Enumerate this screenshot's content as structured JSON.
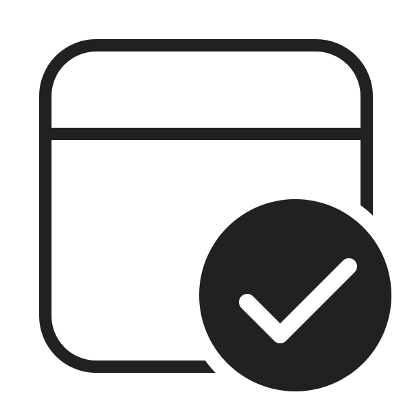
{
  "icon": {
    "name": "calendar-checkmark-icon",
    "color": "#212121",
    "background": "#ffffff"
  }
}
